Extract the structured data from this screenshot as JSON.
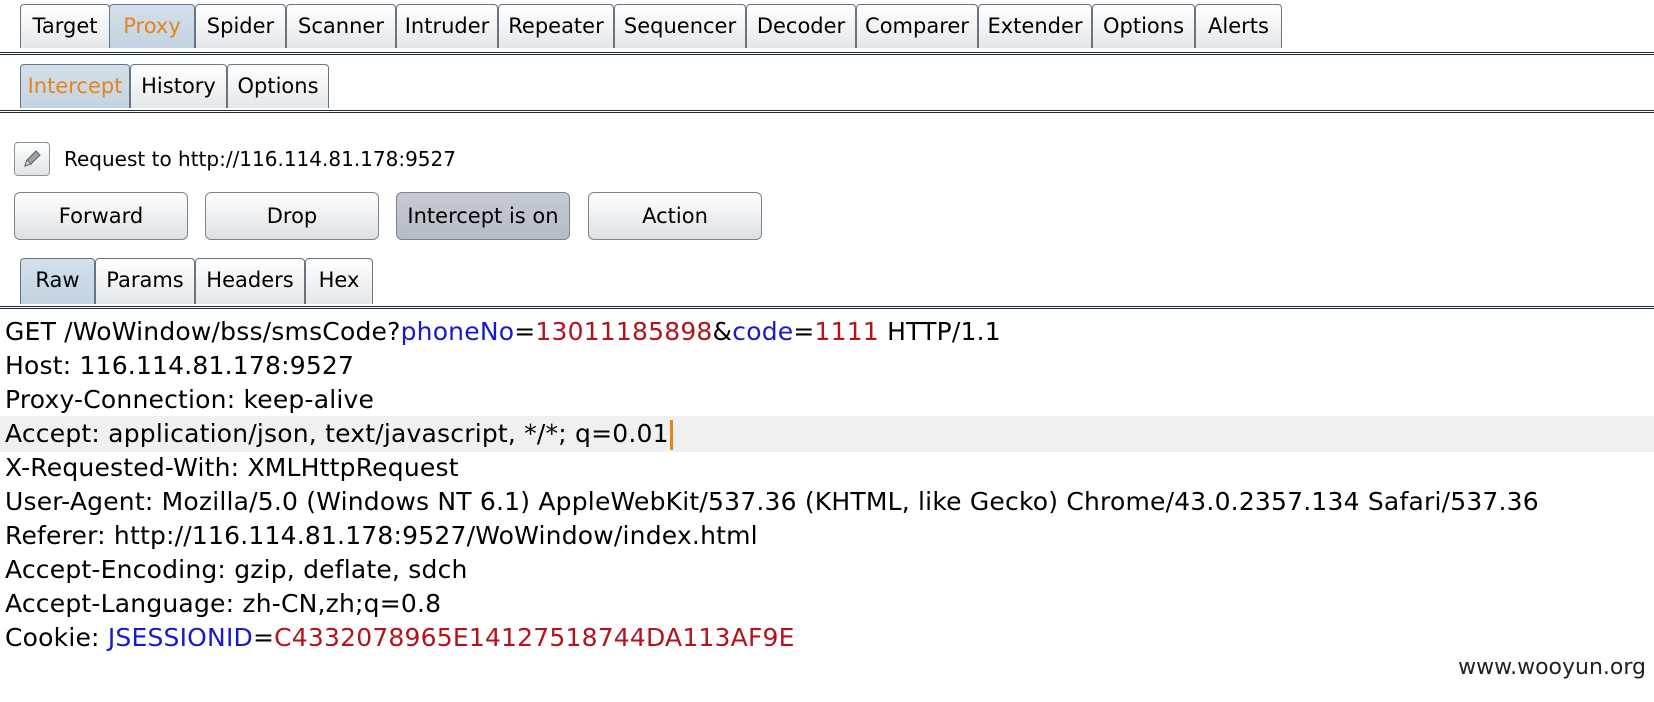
{
  "main_tabs": [
    "Target",
    "Proxy",
    "Spider",
    "Scanner",
    "Intruder",
    "Repeater",
    "Sequencer",
    "Decoder",
    "Comparer",
    "Extender",
    "Options",
    "Alerts"
  ],
  "main_active": "Proxy",
  "sub_tabs": [
    "Intercept",
    "History",
    "Options"
  ],
  "sub_active": "Intercept",
  "request_label": "Request to http://116.114.81.178:9527",
  "buttons": {
    "forward": "Forward",
    "drop": "Drop",
    "intercept": "Intercept is on",
    "action": "Action"
  },
  "message_tabs": [
    "Raw",
    "Params",
    "Headers",
    "Hex"
  ],
  "message_active": "Raw",
  "request": {
    "method_path": "GET /WoWindow/bss/smsCode?",
    "param1_name": "phoneNo",
    "param1_value": "13011185898",
    "param2_name": "code",
    "param2_value": "1111",
    "protocol": " HTTP/1.1",
    "host": "Host: 116.114.81.178:9527",
    "proxy_connection": "Proxy-Connection: keep-alive",
    "accept": "Accept: application/json, text/javascript, */*; q=0.01",
    "x_requested_with": "X-Requested-With: XMLHttpRequest",
    "user_agent": "User-Agent: Mozilla/5.0 (Windows NT 6.1) AppleWebKit/537.36 (KHTML, like Gecko) Chrome/43.0.2357.134 Safari/537.36",
    "referer": "Referer: http://116.114.81.178:9527/WoWindow/index.html",
    "accept_encoding": "Accept-Encoding: gzip, deflate, sdch",
    "accept_language": "Accept-Language: zh-CN,zh;q=0.8",
    "cookie_prefix": "Cookie: ",
    "cookie_name": "JSESSIONID",
    "cookie_value": "C4332078965E14127518744DA113AF9E"
  },
  "watermark": "www.wooyun.org",
  "colors": {
    "active_tab_text": "#e8821d",
    "param_name": "#1818cc",
    "param_value": "#b5121b"
  }
}
